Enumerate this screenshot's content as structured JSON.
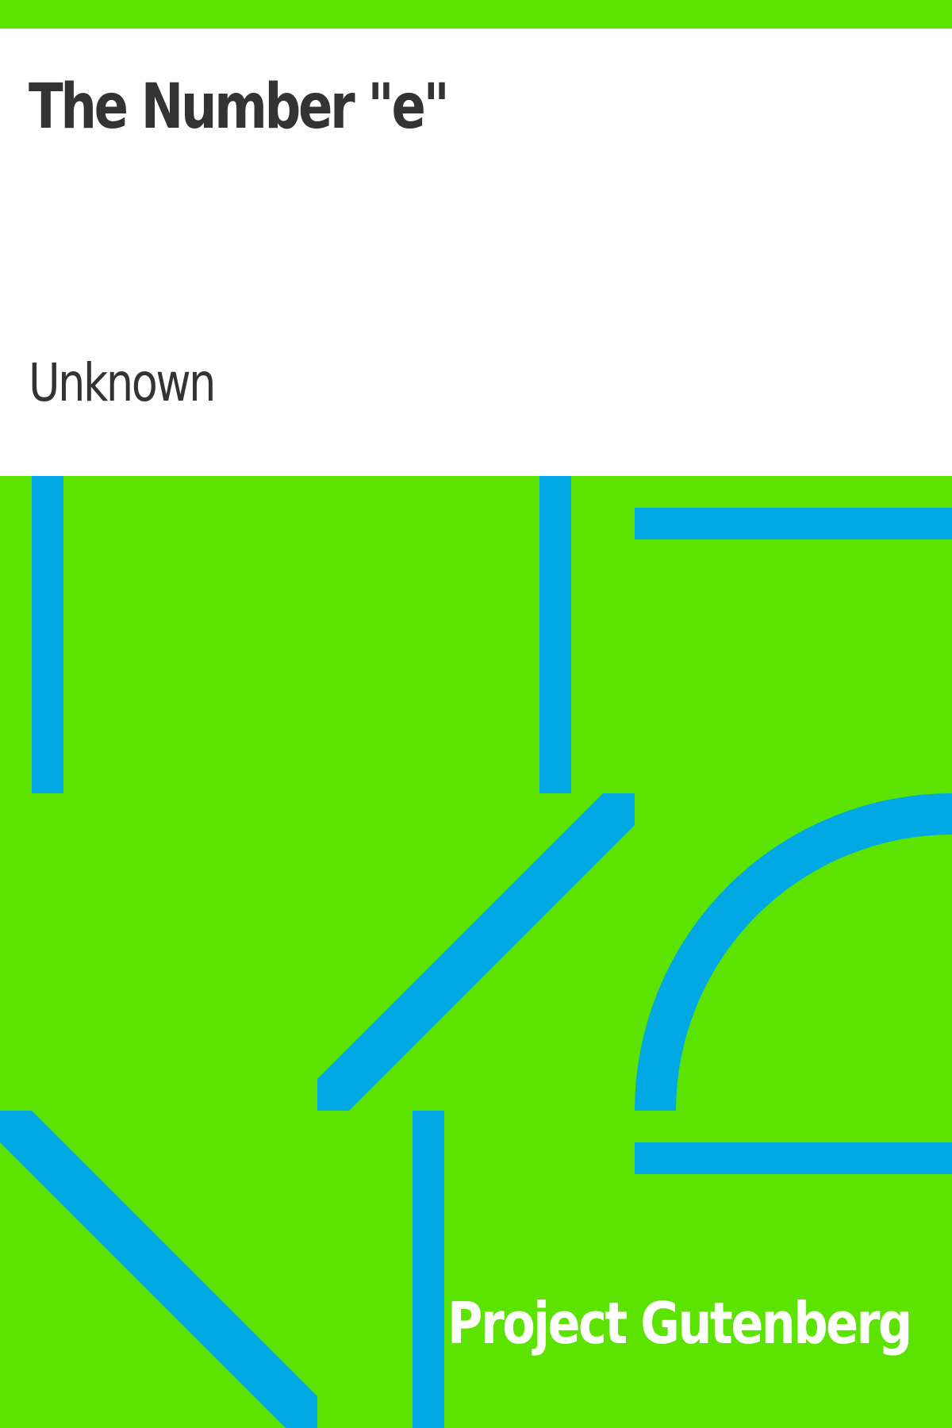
{
  "cover": {
    "title": "The Number \"e\"",
    "author": "Unknown",
    "publisher": "Project Gutenberg"
  },
  "colors": {
    "background": "#5de300",
    "pattern": "#00a9e3",
    "title_panel": "#ffffff",
    "text": "#333333",
    "publisher_text": "#ffffff"
  },
  "icons": {
    "pattern": "geometric-pattern-icon"
  }
}
